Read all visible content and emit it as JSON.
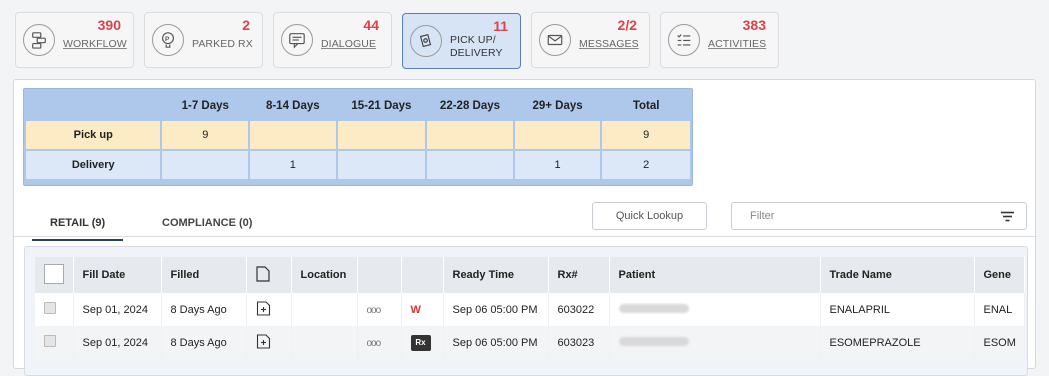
{
  "tiles": [
    {
      "id": "workflow",
      "count": "390",
      "label": "WORKFLOW",
      "icon": "workflow-icon"
    },
    {
      "id": "parked",
      "count": "2",
      "label": "PARKED RX",
      "icon": "parked-rx-icon"
    },
    {
      "id": "dialogue",
      "count": "44",
      "label": "DIALOGUE",
      "icon": "dialogue-icon"
    },
    {
      "id": "pickup",
      "count": "11",
      "label1": "PICK UP/",
      "label2": "DELIVERY",
      "icon": "pickup-delivery-icon"
    },
    {
      "id": "messages",
      "count": "2/2",
      "label": "MESSAGES",
      "icon": "messages-icon"
    },
    {
      "id": "activities",
      "count": "383",
      "label": "ACTIVITIES",
      "icon": "activities-icon"
    }
  ],
  "summary": {
    "headers": [
      "",
      "1-7 Days",
      "8-14 Days",
      "15-21 Days",
      "22-28 Days",
      "29+ Days",
      "Total"
    ],
    "rows": [
      {
        "label": "Pick up",
        "cells": [
          "9",
          "",
          "",
          "",
          "",
          "9"
        ]
      },
      {
        "label": "Delivery",
        "cells": [
          "",
          "1",
          "",
          "",
          "1",
          "2"
        ]
      }
    ]
  },
  "tabs": {
    "retail": "RETAIL (9)",
    "compliance": "COMPLIANCE (0)"
  },
  "quick_lookup": "Quick Lookup",
  "filter": {
    "placeholder": "Filter"
  },
  "grid": {
    "headers": [
      "",
      "Fill Date",
      "Filled",
      "",
      "Location",
      "",
      "",
      "Ready Time",
      "Rx#",
      "Patient",
      "Trade Name",
      "Gene"
    ],
    "rows": [
      {
        "fill_date": "Sep 01, 2024",
        "filled": "8 Days Ago",
        "dots": "ooo",
        "flag": "W",
        "ready": "Sep 06 05:00 PM",
        "rx": "603022",
        "trade": "ENALAPRIL",
        "gen": "ENAL"
      },
      {
        "fill_date": "Sep 01, 2024",
        "filled": "8 Days Ago",
        "dots": "ooo",
        "flag": "Rx",
        "ready": "Sep 06 05:00 PM",
        "rx": "603023",
        "trade": "ESOMEPRAZOLE",
        "gen": "ESOM"
      }
    ]
  }
}
